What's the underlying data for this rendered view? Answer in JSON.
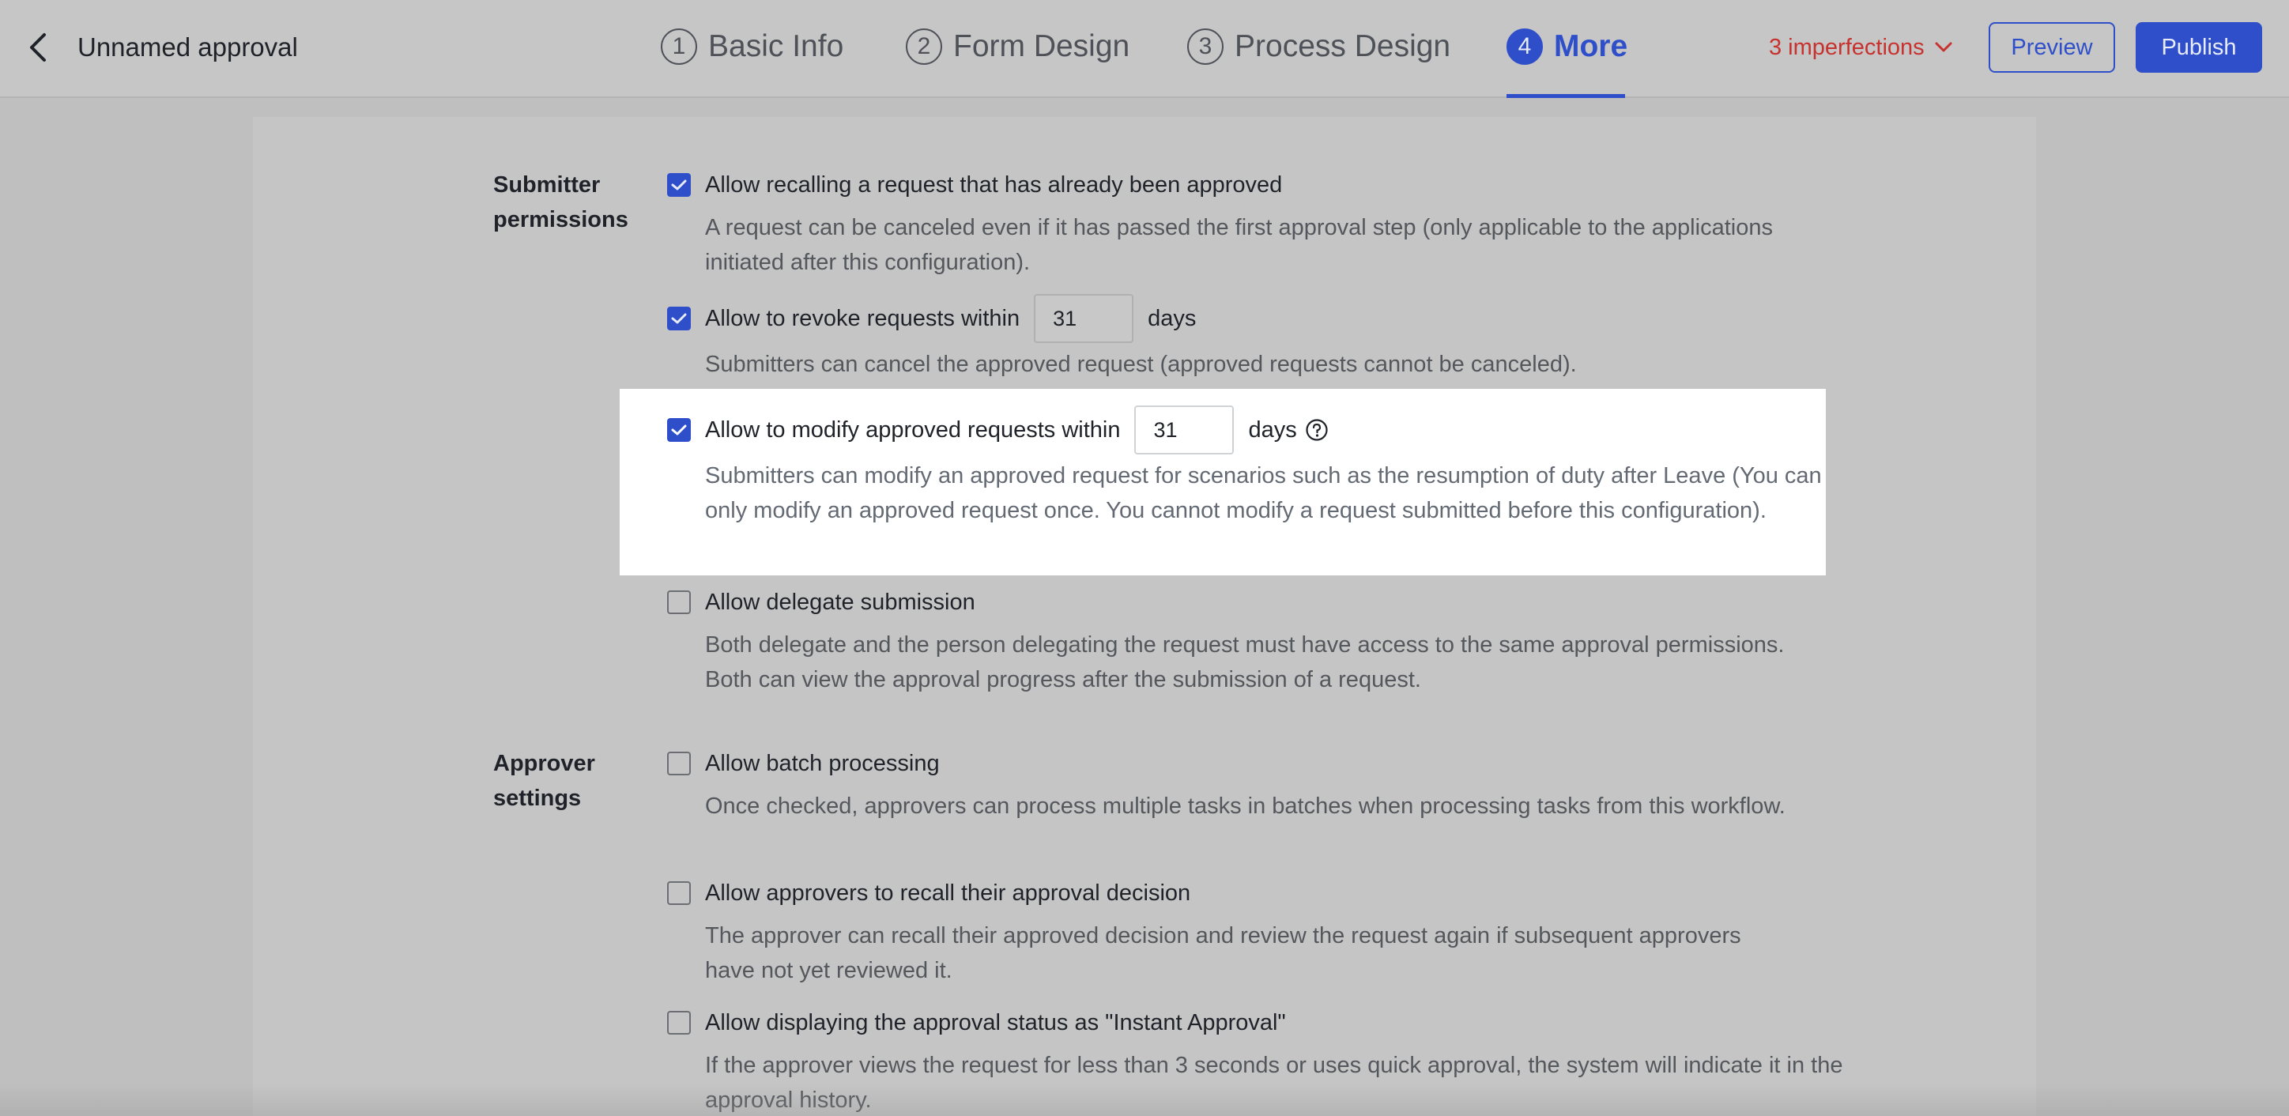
{
  "header": {
    "title": "Unnamed approval",
    "steps": [
      {
        "num": "1",
        "label": "Basic Info"
      },
      {
        "num": "2",
        "label": "Form Design"
      },
      {
        "num": "3",
        "label": "Process Design"
      },
      {
        "num": "4",
        "label": "More"
      }
    ],
    "active_step": 4,
    "imperfections": "3 imperfections",
    "preview_label": "Preview",
    "publish_label": "Publish",
    "accent_color": "#2e4fc9",
    "warning_color": "#c7322f"
  },
  "submitter": {
    "label": "Submitter permissions",
    "options": [
      {
        "checked": true,
        "label": "Allow recalling a request that has already been approved",
        "desc": "A request can be canceled even if it has passed the first approval step (only applicable to the applications initiated after this configuration)."
      },
      {
        "checked": true,
        "label": "Allow to revoke requests within",
        "value": "31",
        "unit": "days",
        "desc": "Submitters can cancel the approved request (approved requests cannot be canceled)."
      },
      {
        "checked": true,
        "label": "Allow to modify approved requests within",
        "value": "31",
        "unit": "days",
        "help_icon": "question-circle-icon",
        "desc": "Submitters can modify an approved request for scenarios such as the resumption of duty after Leave (You can only modify an approved request once. You cannot modify a request submitted before this configuration)."
      },
      {
        "checked": false,
        "label": "Allow delegate submission",
        "desc": "Both delegate and the person delegating the request must have access to the same approval permissions. Both can view the approval progress after the submission of a request."
      }
    ]
  },
  "approver": {
    "label": "Approver settings",
    "options": [
      {
        "checked": false,
        "label": "Allow batch processing",
        "desc": "Once checked, approvers can process multiple tasks in batches when processing tasks from this workflow."
      },
      {
        "checked": false,
        "label": "Allow approvers to recall their approval decision",
        "desc": "The approver can recall their approved decision and review the request again if subsequent approvers have not yet reviewed it."
      },
      {
        "checked": false,
        "label": "Allow displaying the approval status as \"Instant Approval\"",
        "desc": "If the approver views the request for less than 3 seconds or uses quick approval, the system will indicate it in the approval history."
      }
    ]
  }
}
